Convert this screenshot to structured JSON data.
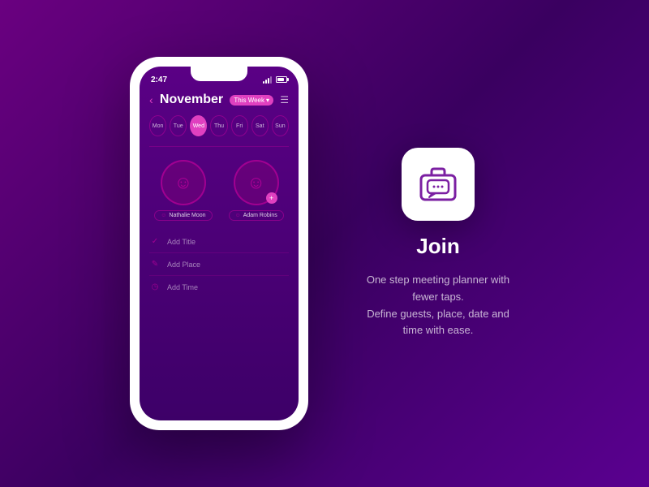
{
  "background": {
    "gradient_start": "#6a0080",
    "gradient_end": "#3a0060"
  },
  "phone": {
    "status_bar": {
      "time": "2:47"
    },
    "calendar": {
      "month": "November",
      "week_badge": "This Week",
      "days": [
        "Mon",
        "Tue",
        "Wed",
        "Thu",
        "Fri",
        "Sat",
        "Sun"
      ],
      "active_day": "Wed"
    },
    "contacts": [
      {
        "name": "Nathalie Moon",
        "has_add": false
      },
      {
        "name": "Adam Robins",
        "has_add": true
      }
    ],
    "form": {
      "items": [
        {
          "icon": "✓",
          "label": "Add Title"
        },
        {
          "icon": "✎",
          "label": "Add Place"
        },
        {
          "icon": "◷",
          "label": "Add Time"
        }
      ]
    }
  },
  "join_section": {
    "title": "Join",
    "description": "One step meeting planner with fewer taps.\nDefine guests, place, date and time with ease."
  }
}
